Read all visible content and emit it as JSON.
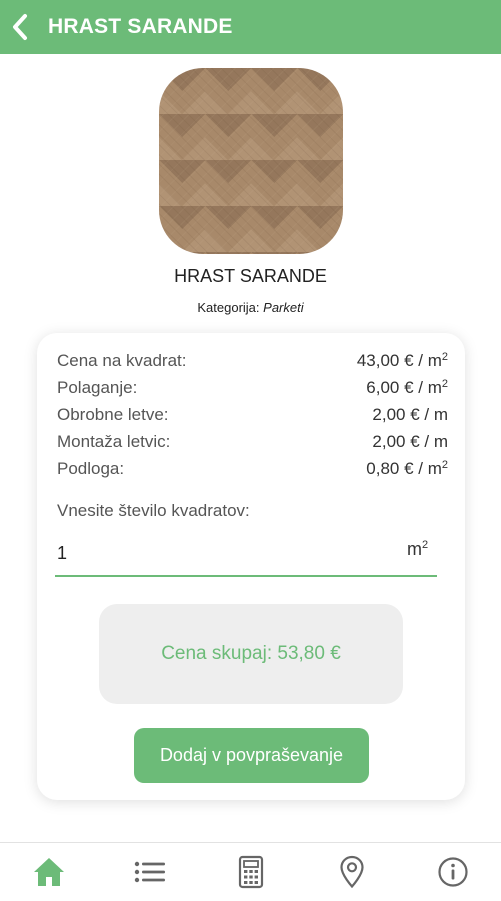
{
  "header": {
    "title": "HRAST SARANDE",
    "back_icon": "chevron-left-icon",
    "background_color": "#6cbb78"
  },
  "product": {
    "name": "HRAST SARANDE",
    "category_label": "Kategorija:",
    "category_value": "Parketi"
  },
  "prices": [
    {
      "label": "Cena na kvadrat:",
      "value": "43,00 € / m",
      "unit_sup": "2"
    },
    {
      "label": "Polaganje:",
      "value": "6,00 € / m",
      "unit_sup": "2"
    },
    {
      "label": "Obrobne letve:",
      "value": "2,00 € / m",
      "unit_sup": ""
    },
    {
      "label": "Montaža letvic:",
      "value": "2,00 € / m",
      "unit_sup": ""
    },
    {
      "label": "Podloga:",
      "value": "0,80 € / m",
      "unit_sup": "2"
    }
  ],
  "quantity": {
    "prompt": "Vnesite število kvadratov:",
    "value": "1",
    "unit": "m",
    "unit_sup": "2"
  },
  "total": {
    "text": "Cena skupaj: 53,80 €"
  },
  "add_button": {
    "label": "Dodaj v povpraševanje"
  },
  "bottom_nav": [
    {
      "icon": "home-icon",
      "active": true
    },
    {
      "icon": "list-icon",
      "active": false
    },
    {
      "icon": "calculator-icon",
      "active": false
    },
    {
      "icon": "location-pin-icon",
      "active": false
    },
    {
      "icon": "info-icon",
      "active": false
    }
  ],
  "colors": {
    "accent": "#6cbb78",
    "icon_inactive": "#666666",
    "total_box_bg": "#eeeeee"
  }
}
